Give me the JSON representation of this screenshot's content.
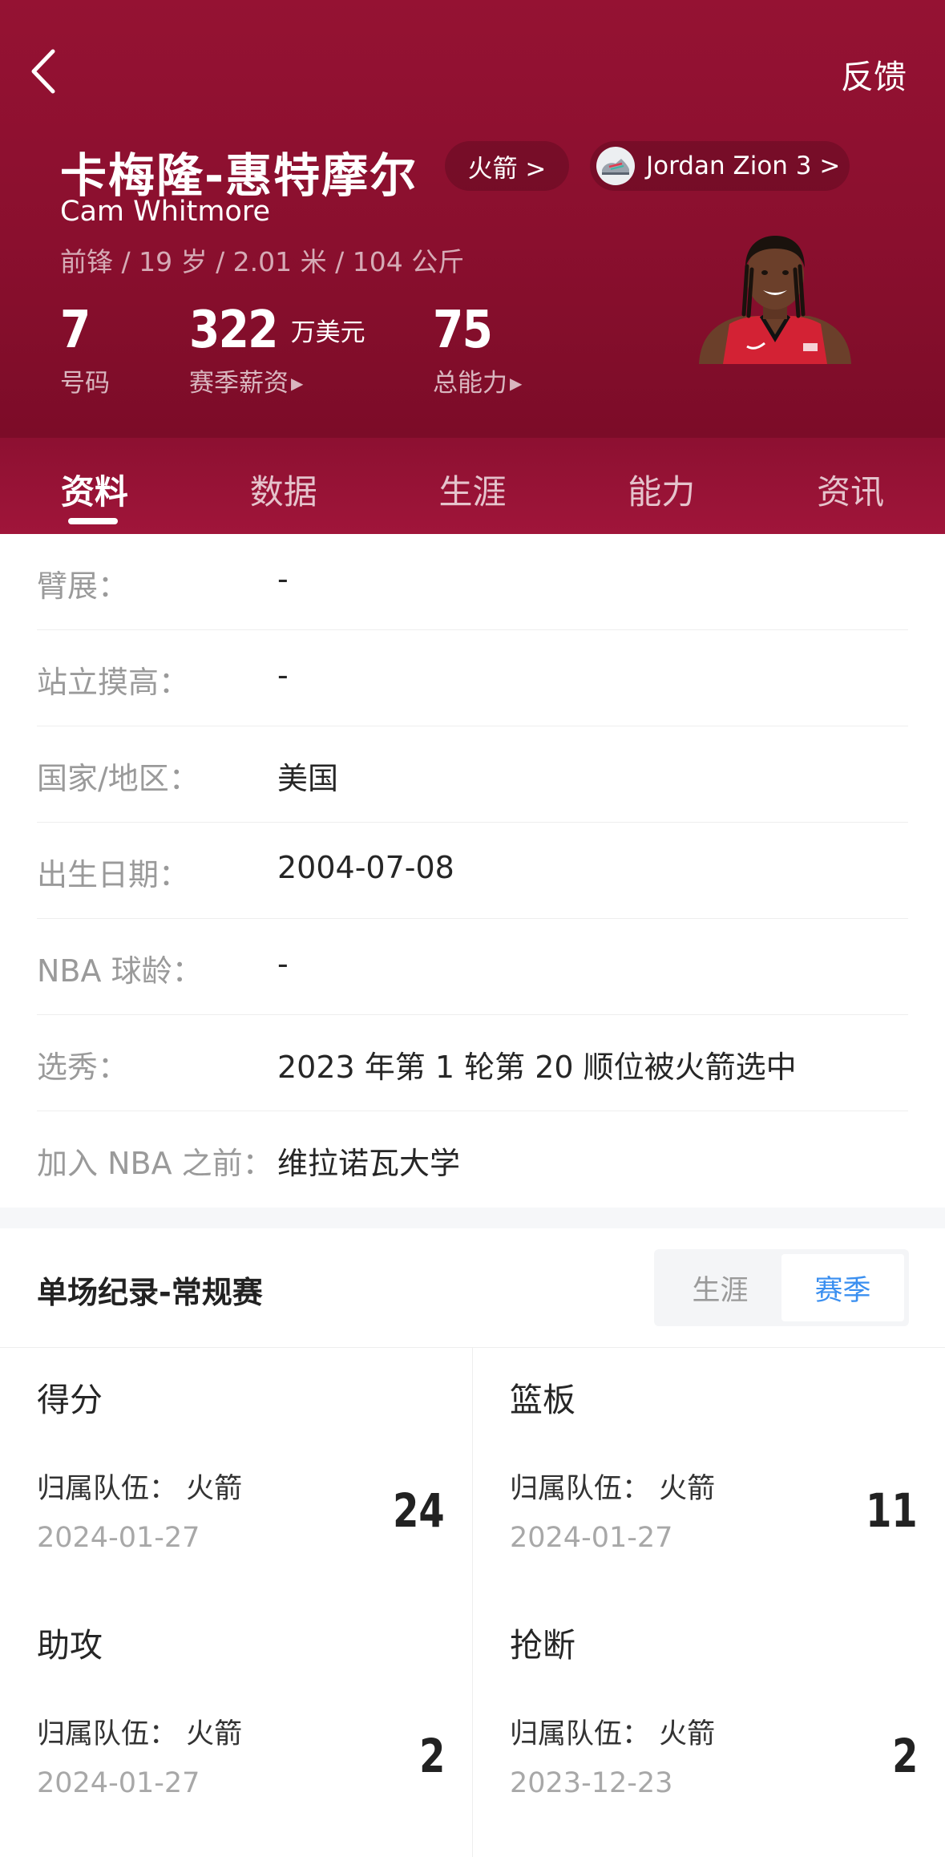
{
  "header": {
    "feedback_label": "反馈",
    "name_zh": "卡梅隆-惠特摩尔",
    "name_en": "Cam Whitmore",
    "team_chip": "火箭 >",
    "shoe_chip": "Jordan Zion 3 >",
    "basic_info": "前锋 / 19 岁 / 2.01 米 / 104 公斤",
    "stats": {
      "number_value": "7",
      "number_label": "号码",
      "salary_value": "322",
      "salary_unit": "万美元",
      "salary_label": "赛季薪资",
      "rating_value": "75",
      "rating_label": "总能力"
    },
    "colors": {
      "header_bg": "#951233",
      "jersey": "#d32234"
    }
  },
  "tabs": [
    {
      "label": "资料",
      "active": true
    },
    {
      "label": "数据",
      "active": false
    },
    {
      "label": "生涯",
      "active": false
    },
    {
      "label": "能力",
      "active": false
    },
    {
      "label": "资讯",
      "active": false
    }
  ],
  "profile": [
    {
      "label": "臂展：",
      "value": "-"
    },
    {
      "label": "站立摸高：",
      "value": "-"
    },
    {
      "label": "国家/地区：",
      "value": "美国"
    },
    {
      "label": "出生日期：",
      "value": "2004-07-08"
    },
    {
      "label": "NBA 球龄：",
      "value": "-"
    },
    {
      "label": "选秀：",
      "value": "2023 年第 1 轮第 20 顺位被火箭选中"
    },
    {
      "label": "加入 NBA 之前：",
      "value": "维拉诺瓦大学"
    }
  ],
  "records": {
    "title": "单场纪录-常规赛",
    "segment": {
      "career": "生涯",
      "season": "赛季",
      "active": "season"
    },
    "items": [
      {
        "title": "得分",
        "team": "归属队伍：  火箭",
        "date": "2024-01-27",
        "value": "24"
      },
      {
        "title": "篮板",
        "team": "归属队伍：  火箭",
        "date": "2024-01-27",
        "value": "11"
      },
      {
        "title": "助攻",
        "team": "归属队伍：  火箭",
        "date": "2024-01-27",
        "value": "2"
      },
      {
        "title": "抢断",
        "team": "归属队伍：  火箭",
        "date": "2023-12-23",
        "value": "2"
      }
    ],
    "accent_color": "#3a8ff0"
  }
}
